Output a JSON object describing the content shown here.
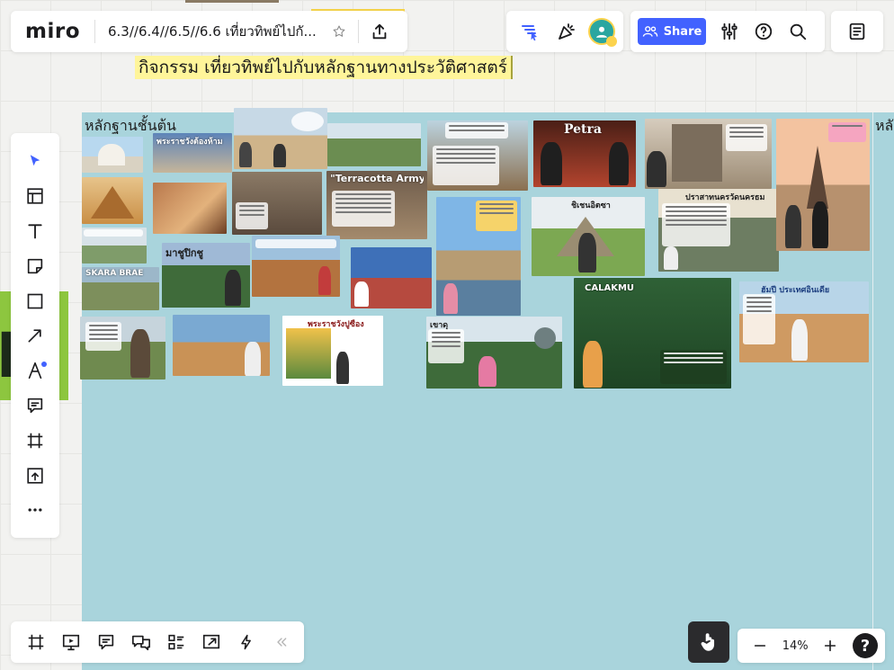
{
  "app": {
    "logo": "miro"
  },
  "board": {
    "name": "6.3//6.4//6.5//6.6 เที่ยวทิพย์ไปกั..."
  },
  "canvas": {
    "activity_title": "กิจกรรม  เที่ยวทิพย์ไปกับหลักฐานทางประวัติศาสตร์",
    "frame_label": "หลักฐานชั้นต้น",
    "frame_label_next": "หลั",
    "cards": [
      {
        "title": "Petra"
      },
      {
        "title": "\"Terracotta Army\""
      },
      {
        "title": "CALAKMU"
      },
      {
        "title": "ปราสาทนครวัดนครธม"
      },
      {
        "title": "มาชูปิกชู"
      },
      {
        "title": "เขาดุ"
      },
      {
        "title": "พระราชวังปูซือง"
      },
      {
        "title": "ฮัมปี ประเทศอินเดีย"
      },
      {
        "title": "SKARA BRAE"
      }
    ]
  },
  "toolbar": {
    "share_label": "Share",
    "tools": [
      {
        "icon": "select-cursor-icon"
      },
      {
        "icon": "templates-icon"
      },
      {
        "icon": "text-icon"
      },
      {
        "icon": "sticky-note-icon"
      },
      {
        "icon": "shape-icon"
      },
      {
        "icon": "connection-line-icon"
      },
      {
        "icon": "pen-icon"
      },
      {
        "icon": "comment-icon"
      },
      {
        "icon": "frame-icon"
      },
      {
        "icon": "upload-icon"
      },
      {
        "icon": "more-icon"
      }
    ]
  },
  "zoom": {
    "level": "14%"
  },
  "colors": {
    "accent": "#4262ff",
    "frame_bg": "#a9d4dc",
    "title_highlight": "#fff59a",
    "green_shape": "#8dc63f"
  }
}
